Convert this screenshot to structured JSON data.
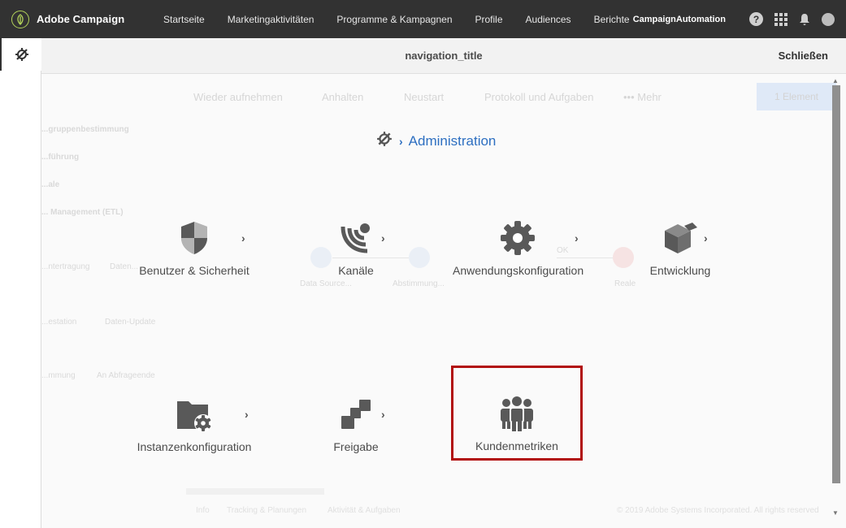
{
  "header": {
    "brand": "Adobe Campaign",
    "nav": [
      "Startseite",
      "Marketingaktivitäten",
      "Programme & Kampagnen",
      "Profile",
      "Audiences",
      "Berichte"
    ],
    "org": "CampaignAutomation",
    "help": "?"
  },
  "modal": {
    "title": "navigation_title",
    "close_label": "Schließen"
  },
  "breadcrumb": {
    "root_icon": "admin-tools-icon",
    "separator": "›",
    "current": "Administration"
  },
  "tiles": [
    {
      "label": "Benutzer & Sicherheit",
      "icon": "shield-icon",
      "chevron": "›"
    },
    {
      "label": "Kanäle",
      "icon": "channels-icon",
      "chevron": "›"
    },
    {
      "label": "Anwendungskonfiguration",
      "icon": "gear-icon",
      "chevron": "›"
    },
    {
      "label": "Entwicklung",
      "icon": "cubes-icon",
      "chevron": "›"
    },
    {
      "label": "Instanzenkonfiguration",
      "icon": "folder-gear-icon",
      "chevron": "›"
    },
    {
      "label": "Freigabe",
      "icon": "deploy-icon",
      "chevron": "›"
    },
    {
      "label": "Kundenmetriken",
      "icon": "users-icon"
    }
  ],
  "background": {
    "toolbar": [
      "Wieder aufnehmen",
      "Anhalten",
      "Neustart",
      "Protokoll und Aufgaben",
      "••• Mehr"
    ],
    "selection_badge": "1 Element",
    "sidebar": [
      "...gruppenbestimmung",
      "...führung",
      "...ale",
      "... Management (ETL)"
    ],
    "nodes": [
      "...ntertragung",
      "Daten...",
      "Data Source...",
      "Abstimmung...",
      "Reale",
      "...estation",
      "Daten-Update",
      "...mmung",
      "An Abfrageende"
    ],
    "connector_label": "OK",
    "footer": [
      "Info",
      "Tracking & Planungen",
      "Aktivität & Aufgaben"
    ],
    "copyright": "© 2019 Adobe Systems Incorporated. All rights reserved"
  },
  "colors": {
    "topbar": "#323232",
    "link": "#2d6fc1",
    "selection": "#b10d0d",
    "icon": "#555555"
  }
}
